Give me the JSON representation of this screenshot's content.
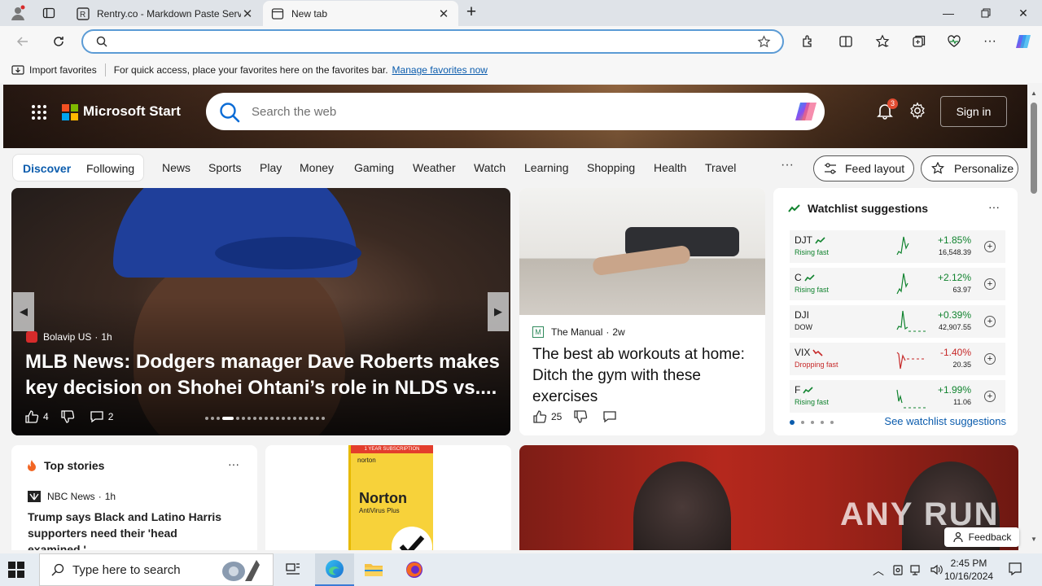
{
  "browser": {
    "tabs": [
      {
        "label": "Rentry.co - Markdown Paste Serv",
        "active": false
      },
      {
        "label": "New tab",
        "active": true
      }
    ],
    "address": {
      "value": "",
      "placeholder": ""
    },
    "favorites_bar": {
      "import_label": "Import favorites",
      "message": "For quick access, place your favorites here on the favorites bar.",
      "link": "Manage favorites now"
    }
  },
  "page": {
    "brand": "Microsoft Start",
    "search_placeholder": "Search the web",
    "notifications_count": "3",
    "signin_label": "Sign in",
    "pills": [
      "Discover",
      "Following"
    ],
    "nav": [
      "News",
      "Sports",
      "Play",
      "Money",
      "Gaming",
      "Weather",
      "Watch",
      "Learning",
      "Shopping",
      "Health",
      "Travel"
    ],
    "more": "···",
    "feed_layout": "Feed layout",
    "personalize": "Personalize",
    "hero": {
      "source": "Bolavip US",
      "age": "1h",
      "headline": "MLB News: Dodgers manager Dave Roberts makes key decision on Shohei Ohtani’s role in NLDS vs....",
      "likes": "4",
      "comments": "2"
    },
    "article": {
      "source": "The Manual",
      "age": "2w",
      "title": "The best ab workouts at home: Ditch the gym with these exercises",
      "likes": "25"
    },
    "watchlist": {
      "title": "Watchlist suggestions",
      "rows": [
        {
          "symbol": "DJT",
          "note": "Rising fast",
          "pct": "+1.85%",
          "price": "16,548.39",
          "up": true
        },
        {
          "symbol": "C",
          "note": "Rising fast",
          "pct": "+2.12%",
          "price": "63.97",
          "up": true
        },
        {
          "symbol": "DJI",
          "note": "DOW",
          "pct": "+0.39%",
          "price": "42,907.55",
          "up": true
        },
        {
          "symbol": "VIX",
          "note": "Dropping fast",
          "pct": "-1.40%",
          "price": "20.35",
          "up": false
        },
        {
          "symbol": "F",
          "note": "Rising fast",
          "pct": "+1.99%",
          "price": "11.06",
          "up": true
        }
      ],
      "see_more": "See watchlist suggestions"
    },
    "top_stories": {
      "title": "Top stories",
      "source": "NBC News",
      "age": "1h",
      "headline": "Trump says Black and Latino Harris supporters need their 'head examined,'..."
    },
    "ad": {
      "band": "1 YEAR SUBSCRIPTION",
      "brand": "Norton",
      "sub": "AntiVirus Plus",
      "logo": "norton"
    },
    "watermark": "ANY RUN",
    "feedback": "Feedback"
  },
  "taskbar": {
    "search_placeholder": "Type here to search",
    "time": "2:45 PM",
    "date": "10/16/2024"
  },
  "colors": {
    "accent": "#0b5cad",
    "up": "#11832f",
    "down": "#c62828"
  }
}
